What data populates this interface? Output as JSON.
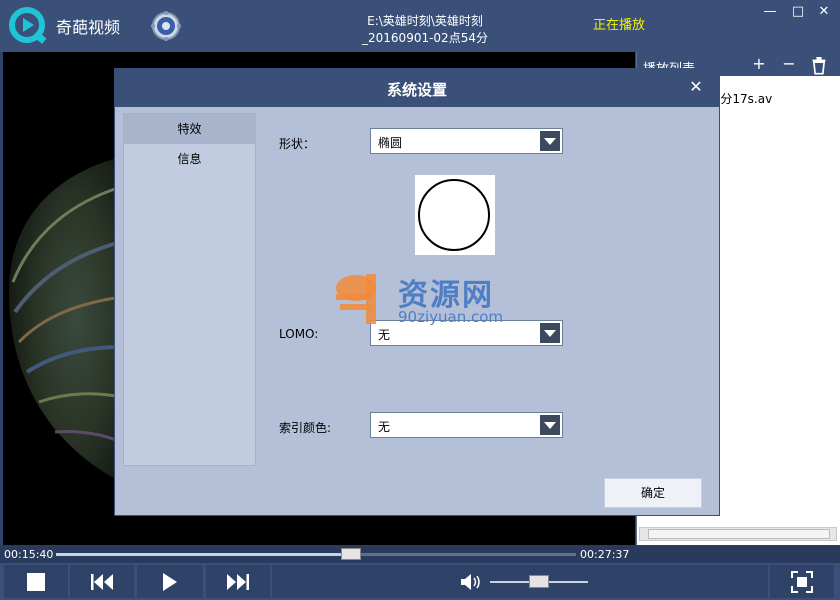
{
  "app": {
    "name": "奇葩视频"
  },
  "titlebar": {
    "file_line1": "E:\\英雄时刻\\英雄时刻",
    "file_line2": "_20160901-02点54分",
    "status": "正在播放",
    "min_glyph": "—",
    "max_glyph": "□",
    "close_glyph": "✕"
  },
  "playlist": {
    "title": "播放列表",
    "add_glyph": "+",
    "remove_glyph": "−",
    "item": "0901-02点54分17s.av"
  },
  "dialog": {
    "title": "系统设置",
    "close_glyph": "✕",
    "nav": [
      {
        "label": "特效",
        "active": true
      },
      {
        "label": "信息",
        "active": false
      }
    ],
    "shape": {
      "label": "形状：",
      "value": "椭圆"
    },
    "lomo": {
      "label": "LOMO:",
      "value": "无"
    },
    "index_color": {
      "label": "索引颜色:",
      "value": "无"
    },
    "ok_label": "确定"
  },
  "watermark": {
    "text": "资源网",
    "url": "90ziyuan.com"
  },
  "player": {
    "time_current": "00:15:40",
    "time_total": "00:27:37",
    "progress": 0.567,
    "volume": 0.5
  },
  "colors": {
    "accent": "#3a5079",
    "status": "#f4f000",
    "dialog_bg": "#b3c0d8"
  }
}
